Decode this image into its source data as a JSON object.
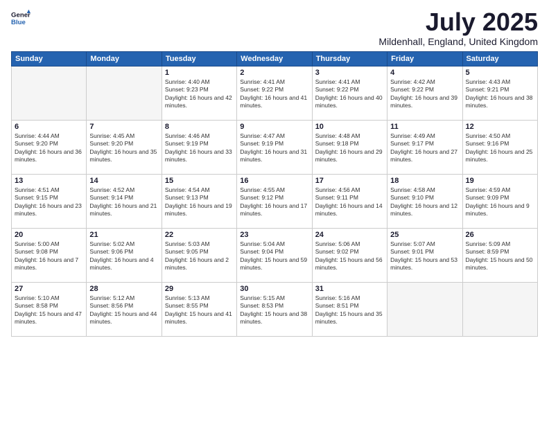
{
  "logo": {
    "general": "General",
    "blue": "Blue"
  },
  "title": "July 2025",
  "subtitle": "Mildenhall, England, United Kingdom",
  "weekdays": [
    "Sunday",
    "Monday",
    "Tuesday",
    "Wednesday",
    "Thursday",
    "Friday",
    "Saturday"
  ],
  "weeks": [
    [
      {
        "day": "",
        "empty": true
      },
      {
        "day": "",
        "empty": true
      },
      {
        "day": "1",
        "sunrise": "Sunrise: 4:40 AM",
        "sunset": "Sunset: 9:23 PM",
        "daylight": "Daylight: 16 hours and 42 minutes."
      },
      {
        "day": "2",
        "sunrise": "Sunrise: 4:41 AM",
        "sunset": "Sunset: 9:22 PM",
        "daylight": "Daylight: 16 hours and 41 minutes."
      },
      {
        "day": "3",
        "sunrise": "Sunrise: 4:41 AM",
        "sunset": "Sunset: 9:22 PM",
        "daylight": "Daylight: 16 hours and 40 minutes."
      },
      {
        "day": "4",
        "sunrise": "Sunrise: 4:42 AM",
        "sunset": "Sunset: 9:22 PM",
        "daylight": "Daylight: 16 hours and 39 minutes."
      },
      {
        "day": "5",
        "sunrise": "Sunrise: 4:43 AM",
        "sunset": "Sunset: 9:21 PM",
        "daylight": "Daylight: 16 hours and 38 minutes."
      }
    ],
    [
      {
        "day": "6",
        "sunrise": "Sunrise: 4:44 AM",
        "sunset": "Sunset: 9:20 PM",
        "daylight": "Daylight: 16 hours and 36 minutes."
      },
      {
        "day": "7",
        "sunrise": "Sunrise: 4:45 AM",
        "sunset": "Sunset: 9:20 PM",
        "daylight": "Daylight: 16 hours and 35 minutes."
      },
      {
        "day": "8",
        "sunrise": "Sunrise: 4:46 AM",
        "sunset": "Sunset: 9:19 PM",
        "daylight": "Daylight: 16 hours and 33 minutes."
      },
      {
        "day": "9",
        "sunrise": "Sunrise: 4:47 AM",
        "sunset": "Sunset: 9:19 PM",
        "daylight": "Daylight: 16 hours and 31 minutes."
      },
      {
        "day": "10",
        "sunrise": "Sunrise: 4:48 AM",
        "sunset": "Sunset: 9:18 PM",
        "daylight": "Daylight: 16 hours and 29 minutes."
      },
      {
        "day": "11",
        "sunrise": "Sunrise: 4:49 AM",
        "sunset": "Sunset: 9:17 PM",
        "daylight": "Daylight: 16 hours and 27 minutes."
      },
      {
        "day": "12",
        "sunrise": "Sunrise: 4:50 AM",
        "sunset": "Sunset: 9:16 PM",
        "daylight": "Daylight: 16 hours and 25 minutes."
      }
    ],
    [
      {
        "day": "13",
        "sunrise": "Sunrise: 4:51 AM",
        "sunset": "Sunset: 9:15 PM",
        "daylight": "Daylight: 16 hours and 23 minutes."
      },
      {
        "day": "14",
        "sunrise": "Sunrise: 4:52 AM",
        "sunset": "Sunset: 9:14 PM",
        "daylight": "Daylight: 16 hours and 21 minutes."
      },
      {
        "day": "15",
        "sunrise": "Sunrise: 4:54 AM",
        "sunset": "Sunset: 9:13 PM",
        "daylight": "Daylight: 16 hours and 19 minutes."
      },
      {
        "day": "16",
        "sunrise": "Sunrise: 4:55 AM",
        "sunset": "Sunset: 9:12 PM",
        "daylight": "Daylight: 16 hours and 17 minutes."
      },
      {
        "day": "17",
        "sunrise": "Sunrise: 4:56 AM",
        "sunset": "Sunset: 9:11 PM",
        "daylight": "Daylight: 16 hours and 14 minutes."
      },
      {
        "day": "18",
        "sunrise": "Sunrise: 4:58 AM",
        "sunset": "Sunset: 9:10 PM",
        "daylight": "Daylight: 16 hours and 12 minutes."
      },
      {
        "day": "19",
        "sunrise": "Sunrise: 4:59 AM",
        "sunset": "Sunset: 9:09 PM",
        "daylight": "Daylight: 16 hours and 9 minutes."
      }
    ],
    [
      {
        "day": "20",
        "sunrise": "Sunrise: 5:00 AM",
        "sunset": "Sunset: 9:08 PM",
        "daylight": "Daylight: 16 hours and 7 minutes."
      },
      {
        "day": "21",
        "sunrise": "Sunrise: 5:02 AM",
        "sunset": "Sunset: 9:06 PM",
        "daylight": "Daylight: 16 hours and 4 minutes."
      },
      {
        "day": "22",
        "sunrise": "Sunrise: 5:03 AM",
        "sunset": "Sunset: 9:05 PM",
        "daylight": "Daylight: 16 hours and 2 minutes."
      },
      {
        "day": "23",
        "sunrise": "Sunrise: 5:04 AM",
        "sunset": "Sunset: 9:04 PM",
        "daylight": "Daylight: 15 hours and 59 minutes."
      },
      {
        "day": "24",
        "sunrise": "Sunrise: 5:06 AM",
        "sunset": "Sunset: 9:02 PM",
        "daylight": "Daylight: 15 hours and 56 minutes."
      },
      {
        "day": "25",
        "sunrise": "Sunrise: 5:07 AM",
        "sunset": "Sunset: 9:01 PM",
        "daylight": "Daylight: 15 hours and 53 minutes."
      },
      {
        "day": "26",
        "sunrise": "Sunrise: 5:09 AM",
        "sunset": "Sunset: 8:59 PM",
        "daylight": "Daylight: 15 hours and 50 minutes."
      }
    ],
    [
      {
        "day": "27",
        "sunrise": "Sunrise: 5:10 AM",
        "sunset": "Sunset: 8:58 PM",
        "daylight": "Daylight: 15 hours and 47 minutes."
      },
      {
        "day": "28",
        "sunrise": "Sunrise: 5:12 AM",
        "sunset": "Sunset: 8:56 PM",
        "daylight": "Daylight: 15 hours and 44 minutes."
      },
      {
        "day": "29",
        "sunrise": "Sunrise: 5:13 AM",
        "sunset": "Sunset: 8:55 PM",
        "daylight": "Daylight: 15 hours and 41 minutes."
      },
      {
        "day": "30",
        "sunrise": "Sunrise: 5:15 AM",
        "sunset": "Sunset: 8:53 PM",
        "daylight": "Daylight: 15 hours and 38 minutes."
      },
      {
        "day": "31",
        "sunrise": "Sunrise: 5:16 AM",
        "sunset": "Sunset: 8:51 PM",
        "daylight": "Daylight: 15 hours and 35 minutes."
      },
      {
        "day": "",
        "empty": true
      },
      {
        "day": "",
        "empty": true
      }
    ]
  ]
}
